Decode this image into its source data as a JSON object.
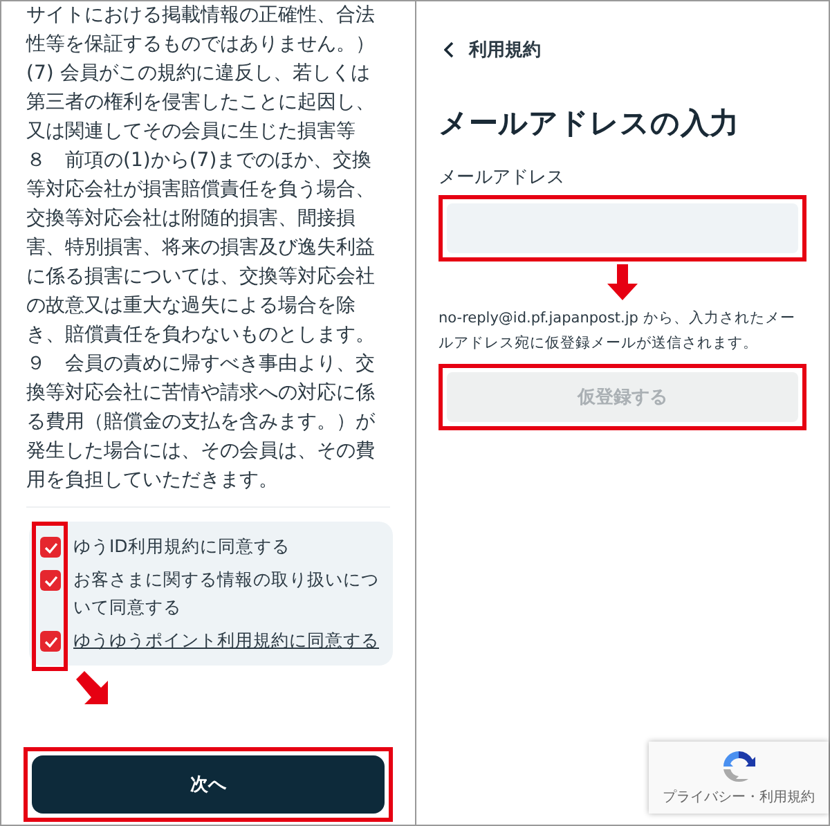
{
  "terms_screen": {
    "paragraphs": [
      "サイトにおける掲載情報の正確性、合法性等を保証するものではありません。）",
      "(7) 会員がこの規約に違反し、若しくは第三者の権利を侵害したことに起因し、又は関連してその会員に生じた損害等",
      "８　前項の(1)から(7)までのほか、交換等対応会社が損害賠償責任を負う場合、交換等対応会社は附随的損害、間接損害、特別損害、将来の損害及び逸失利益に係る損害については、交換等対応会社の故意又は重大な過失による場合を除き、賠償責任を負わないものとします。",
      "９　会員の責めに帰すべき事由より、交換等対応会社に苦情や請求への対応に係る費用（賠償金の支払を含みます。）が発生した場合には、その会員は、その費用を負担していただきます。"
    ],
    "agreements": {
      "highlighted": true,
      "items": [
        {
          "label": "ゆうID利用規約に同意する",
          "checked": true,
          "kind": "text"
        },
        {
          "label": "お客さまに関する情報の取り扱いについて同意する",
          "checked": true,
          "kind": "text"
        },
        {
          "label": "ゆうゆうポイント利用規約に同意する",
          "checked": true,
          "kind": "link"
        }
      ]
    },
    "next_button": {
      "label": "次へ",
      "highlighted": true
    }
  },
  "email_screen": {
    "back_label": "利用規約",
    "title": "メールアドレスの入力",
    "field": {
      "label": "メールアドレス",
      "highlighted": true
    },
    "note": "no-reply@id.pf.japanpost.jp から、入力されたメールアドレス宛に仮登録メールが送信されます。",
    "submit_button": {
      "label": "仮登録する",
      "disabled": true,
      "highlighted": true
    },
    "recaptcha": {
      "links": "プライバシー・利用規約"
    }
  }
}
